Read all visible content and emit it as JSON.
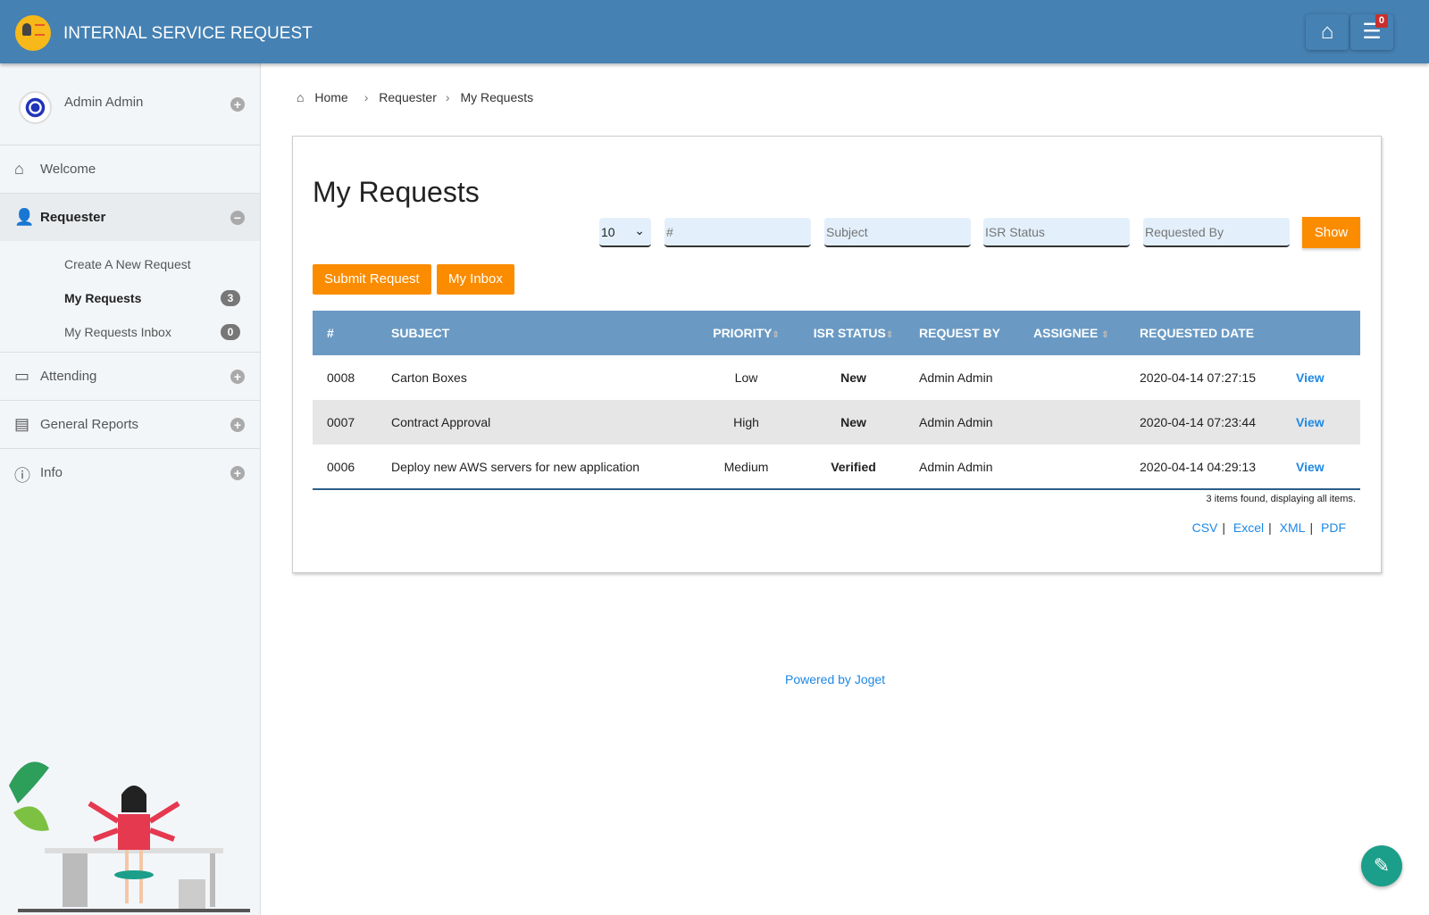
{
  "header": {
    "title": "INTERNAL SERVICE REQUEST",
    "inbox_count": "0"
  },
  "sidebar": {
    "user": "Admin Admin",
    "items": [
      {
        "label": "Welcome"
      },
      {
        "label": "Requester"
      },
      {
        "label": "Attending"
      },
      {
        "label": "General Reports"
      },
      {
        "label": "Info"
      }
    ],
    "subitems": [
      {
        "label": "Create A New Request"
      },
      {
        "label": "My Requests",
        "count": "3"
      },
      {
        "label": "My Requests Inbox",
        "count": "0"
      }
    ]
  },
  "breadcrumb": [
    "Home",
    "Requester",
    "My Requests"
  ],
  "page": {
    "title": "My Requests",
    "filters": {
      "page_size": "10",
      "id_placeholder": "#",
      "subject_placeholder": "Subject",
      "status_placeholder": "ISR Status",
      "requested_by_placeholder": "Requested By",
      "show_label": "Show"
    },
    "buttons": {
      "submit": "Submit Request",
      "inbox": "My Inbox"
    },
    "columns": [
      "#",
      "SUBJECT",
      "PRIORITY",
      "ISR STATUS",
      "REQUEST BY",
      "ASSIGNEE",
      "REQUESTED DATE"
    ],
    "rows": [
      {
        "id": "0008",
        "subject": "Carton Boxes",
        "priority": "Low",
        "status": "New",
        "by": "Admin Admin",
        "assignee": "",
        "date": "2020-04-14 07:27:15",
        "action": "View"
      },
      {
        "id": "0007",
        "subject": "Contract Approval",
        "priority": "High",
        "status": "New",
        "by": "Admin Admin",
        "assignee": "",
        "date": "2020-04-14 07:23:44",
        "action": "View"
      },
      {
        "id": "0006",
        "subject": "Deploy new AWS servers for new application",
        "priority": "Medium",
        "status": "Verified",
        "by": "Admin Admin",
        "assignee": "",
        "date": "2020-04-14 04:29:13",
        "action": "View"
      }
    ],
    "found": "3 items found, displaying all items.",
    "exports": [
      "CSV",
      "Excel",
      "XML",
      "PDF"
    ]
  },
  "footer": {
    "powered": "Powered by Joget"
  }
}
